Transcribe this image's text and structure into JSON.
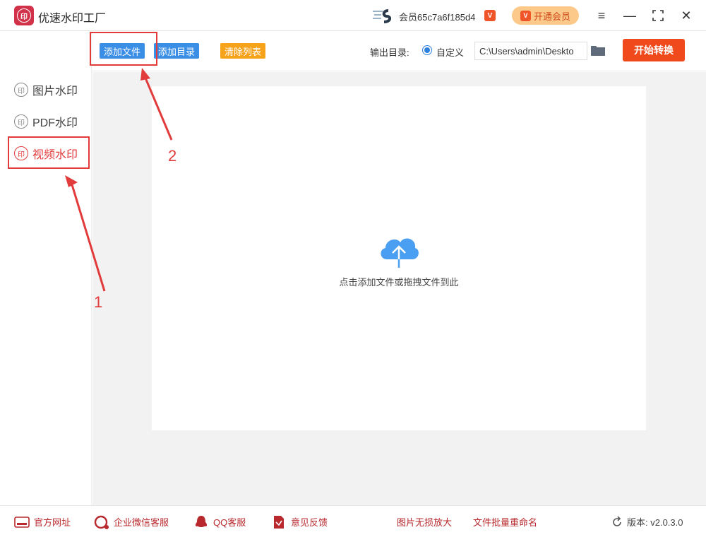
{
  "titlebar": {
    "title": "优速水印工厂",
    "logo_text": "印",
    "user_name": "会员65c7a6f185d4",
    "vip_badge": "V",
    "open_vip_label": "开通会员",
    "menu_icon": "≡",
    "minimize_icon": "—",
    "maximize_icon": "⛶",
    "close_icon": "✕"
  },
  "sidebar": {
    "items": [
      {
        "label": "图片水印",
        "icon": "印"
      },
      {
        "label": "PDF水印",
        "icon": "印"
      },
      {
        "label": "视频水印",
        "icon": "印"
      }
    ],
    "active_color": "#e23b3b"
  },
  "toolbar": {
    "add_file_label": "添加文件",
    "add_dir_label": "添加目录",
    "clear_list_label": "清除列表",
    "output_label": "输出目录:",
    "radio_label": "自定义",
    "output_path": "C:\\Users\\admin\\Deskto",
    "start_label": "开始转换"
  },
  "dropzone": {
    "hint": "点击添加文件或拖拽文件到此"
  },
  "footer": {
    "website": "官方网址",
    "wechat": "企业微信客服",
    "qq": "QQ客服",
    "feedback": "意见反馈",
    "lossless": "图片无损放大",
    "rename": "文件批量重命名",
    "version": "版本: v2.0.3.0"
  },
  "annotations": {
    "label_1": "1",
    "label_2": "2",
    "color": "#e23b3b"
  },
  "colors": {
    "accent_blue": "#3a8ee6",
    "clear_orange": "#f7a21b",
    "start_red": "#f04a1c",
    "cloud_blue": "#4a9ff2"
  }
}
